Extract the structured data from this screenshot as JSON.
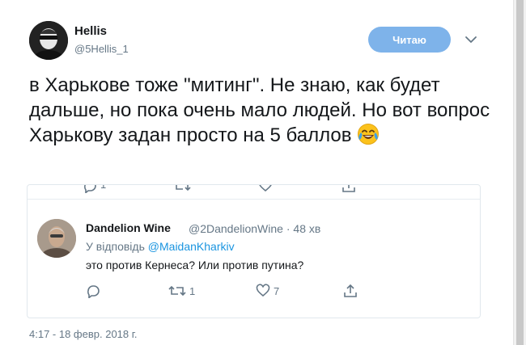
{
  "tweet": {
    "author_name": "Hellis",
    "author_handle": "@5Hellis_1",
    "follow_label": "Читаю",
    "text": "в Харькове тоже \"митинг\". Не знаю, как будет дальше, но пока очень мало людей. Но вот вопрос Харькову задан просто на 5 баллов",
    "emoji": "face-with-tears-of-joy",
    "timestamp": "4:17 - 18 февр. 2018 г."
  },
  "clipped_actions": {
    "reply_count": "1",
    "retweet_count": ""
  },
  "reply": {
    "author_name": "Dandelion Wine",
    "author_handle": "@2DandelionWine",
    "separator": "·",
    "time": "48 хв",
    "in_reply_prefix": "У відповідь",
    "in_reply_to": "@MaidanKharkiv",
    "text": "это против Кернеса? Или против путина?",
    "retweet_count": "1",
    "like_count": "7"
  },
  "icons": [
    "caret-down-icon",
    "reply-icon",
    "retweet-icon",
    "like-icon",
    "share-icon"
  ],
  "colors": {
    "follow_button": "#7eb3ea",
    "mention": "#1b95e0",
    "secondary_text": "#657786"
  }
}
